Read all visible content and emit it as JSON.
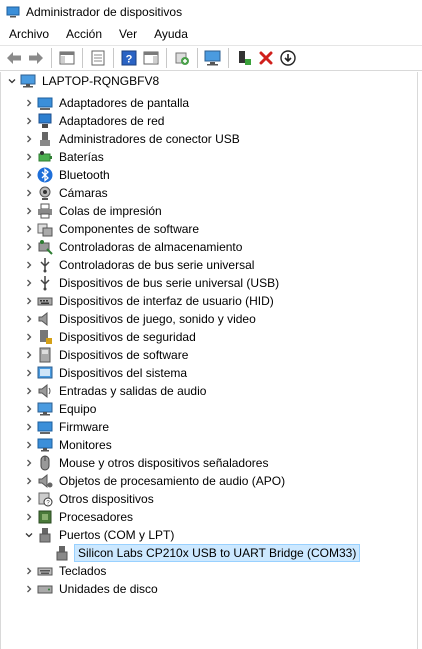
{
  "window": {
    "title": "Administrador de dispositivos"
  },
  "menu": [
    "Archivo",
    "Acción",
    "Ver",
    "Ayuda"
  ],
  "toolbar": [
    {
      "icon": "back-arrow-icon"
    },
    {
      "icon": "forward-arrow-icon"
    },
    {
      "icon": "show-hide-tree-icon"
    },
    {
      "icon": "properties-icon"
    },
    {
      "icon": "help-icon"
    },
    {
      "icon": "action-pane-icon"
    },
    {
      "icon": "update-driver-icon"
    },
    {
      "icon": "scan-hardware-icon"
    },
    {
      "icon": "enable-device-icon"
    },
    {
      "icon": "uninstall-device-icon"
    },
    {
      "icon": "disable-device-icon"
    }
  ],
  "tree": {
    "root": {
      "label": "LAPTOP-RQNGBFV8",
      "expanded": true
    },
    "categories": [
      {
        "label": "Adaptadores de pantalla",
        "icon": "display-adapter-icon"
      },
      {
        "label": "Adaptadores de red",
        "icon": "network-adapter-icon"
      },
      {
        "label": "Administradores de conector USB",
        "icon": "usb-connector-icon"
      },
      {
        "label": "Baterías",
        "icon": "battery-icon"
      },
      {
        "label": "Bluetooth",
        "icon": "bluetooth-icon"
      },
      {
        "label": "Cámaras",
        "icon": "camera-icon"
      },
      {
        "label": "Colas de impresión",
        "icon": "printer-icon"
      },
      {
        "label": "Componentes de software",
        "icon": "software-component-icon"
      },
      {
        "label": "Controladoras de almacenamiento",
        "icon": "storage-controller-icon"
      },
      {
        "label": "Controladoras de bus serie universal",
        "icon": "usb-controller-icon"
      },
      {
        "label": "Dispositivos de bus serie universal (USB)",
        "icon": "usb-device-icon"
      },
      {
        "label": "Dispositivos de interfaz de usuario (HID)",
        "icon": "hid-icon"
      },
      {
        "label": "Dispositivos de juego, sonido y video",
        "icon": "speaker-icon"
      },
      {
        "label": "Dispositivos de seguridad",
        "icon": "security-device-icon"
      },
      {
        "label": "Dispositivos de software",
        "icon": "software-device-icon"
      },
      {
        "label": "Dispositivos del sistema",
        "icon": "system-device-icon"
      },
      {
        "label": "Entradas y salidas de audio",
        "icon": "audio-io-icon"
      },
      {
        "label": "Equipo",
        "icon": "computer-icon"
      },
      {
        "label": "Firmware",
        "icon": "firmware-icon"
      },
      {
        "label": "Monitores",
        "icon": "monitor-icon"
      },
      {
        "label": "Mouse y otros dispositivos señaladores",
        "icon": "mouse-icon"
      },
      {
        "label": "Objetos de procesamiento de audio (APO)",
        "icon": "audio-apo-icon"
      },
      {
        "label": "Otros dispositivos",
        "icon": "other-devices-icon"
      },
      {
        "label": "Procesadores",
        "icon": "processor-icon"
      },
      {
        "label": "Puertos (COM y LPT)",
        "icon": "port-icon",
        "expanded": true,
        "children": [
          {
            "label": "Silicon Labs CP210x USB to UART Bridge (COM33)",
            "icon": "port-device-icon",
            "selected": true
          }
        ]
      },
      {
        "label": "Teclados",
        "icon": "keyboard-icon"
      },
      {
        "label": "Unidades de disco",
        "icon": "disk-drive-icon"
      }
    ]
  }
}
